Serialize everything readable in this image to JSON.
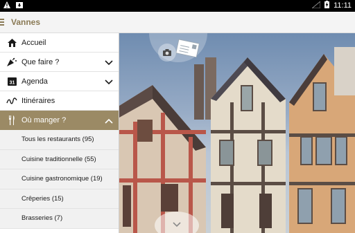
{
  "status_bar": {
    "time": "11:11"
  },
  "app_bar": {
    "title": "Vannes"
  },
  "nav": {
    "items": [
      {
        "label": "Accueil"
      },
      {
        "label": "Que faire ?"
      },
      {
        "label": "Agenda"
      },
      {
        "label": "Itinéraires"
      },
      {
        "label": "Où manger ?"
      }
    ],
    "agenda_icon_text": "31",
    "sub_items": [
      {
        "label": "Tous les restaurants (95)"
      },
      {
        "label": "Cuisine traditionnelle (55)"
      },
      {
        "label": "Cuisine gastronomique (19)"
      },
      {
        "label": "Crêperies (15)"
      },
      {
        "label": "Brasseries (7)"
      }
    ]
  },
  "colors": {
    "accent": "#9b8a65",
    "title": "#8a7a55",
    "status_bar": "#000000"
  }
}
